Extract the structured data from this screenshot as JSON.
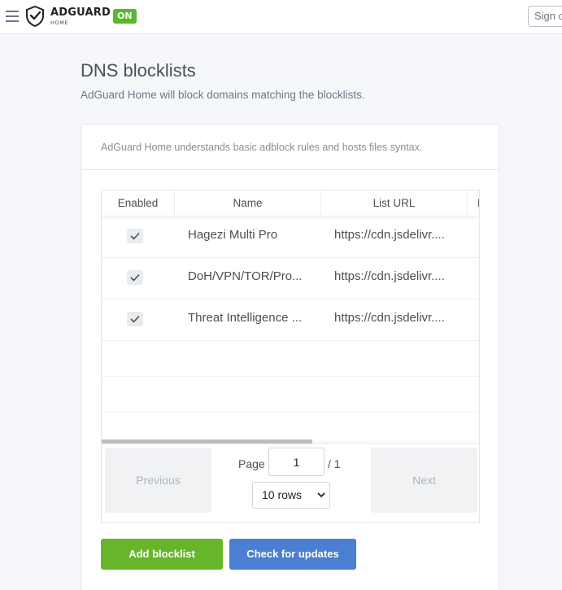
{
  "header": {
    "brand": "ADGUARD",
    "brand_sub": "HOME",
    "status_badge": "ON",
    "signout_label": "Sign out"
  },
  "page": {
    "title": "DNS blocklists",
    "subtitle": "AdGuard Home will block domains matching the blocklists."
  },
  "card": {
    "header_text": "AdGuard Home understands basic adblock rules and hosts files syntax."
  },
  "table": {
    "columns": [
      "Enabled",
      "Name",
      "List URL",
      "R"
    ],
    "rows": [
      {
        "enabled": true,
        "name": "Hagezi Multi Pro",
        "url": "https://cdn.jsdelivr...."
      },
      {
        "enabled": true,
        "name": "DoH/VPN/TOR/Pro...",
        "url": "https://cdn.jsdelivr...."
      },
      {
        "enabled": true,
        "name": "Threat Intelligence ...",
        "url": "https://cdn.jsdelivr...."
      }
    ]
  },
  "pagination": {
    "previous_label": "Previous",
    "next_label": "Next",
    "page_label": "Page",
    "page_value": "1",
    "page_total": "/ 1",
    "rows_selected": "10 rows"
  },
  "actions": {
    "add_label": "Add blocklist",
    "check_label": "Check for updates"
  },
  "colors": {
    "accent_green": "#67b52a",
    "accent_blue": "#4a7fd1",
    "badge_green": "#58b82d"
  }
}
